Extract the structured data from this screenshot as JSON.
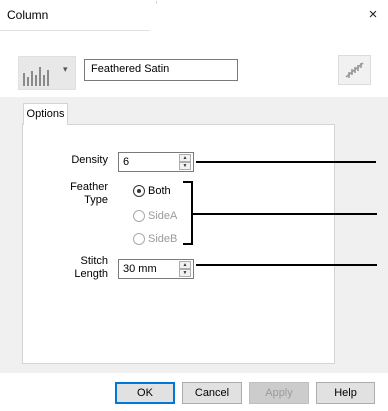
{
  "window": {
    "title": "Column",
    "close_glyph": "×"
  },
  "toolbar": {
    "type_icon": "column-chart-icon",
    "dropdown_glyph": "▾",
    "name_value": "Feathered Satin",
    "extra_icon": "feather-icon"
  },
  "tabs": [
    {
      "label": "Options"
    }
  ],
  "options": {
    "density": {
      "label": "Density",
      "value": "6"
    },
    "feather_type": {
      "label": "Feather Type",
      "choices": [
        {
          "label": "Both",
          "selected": true,
          "enabled": true
        },
        {
          "label": "SideA",
          "selected": false,
          "enabled": false
        },
        {
          "label": "SideB",
          "selected": false,
          "enabled": false
        }
      ]
    },
    "stitch_length": {
      "label": "Stitch Length",
      "value": "30 mm"
    }
  },
  "buttons": {
    "ok": "OK",
    "cancel": "Cancel",
    "apply": "Apply",
    "help": "Help"
  },
  "spin_glyphs": {
    "up": "▲",
    "down": "▼"
  }
}
